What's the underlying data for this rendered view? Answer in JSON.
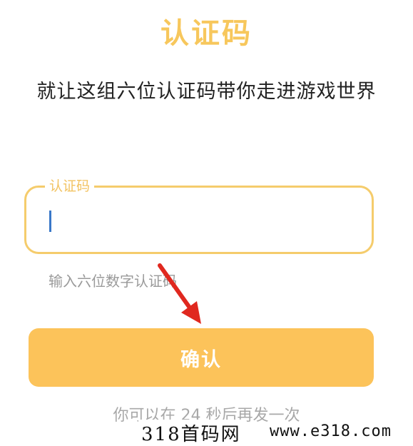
{
  "header": {
    "title": "认证码",
    "subtitle": "就让这组六位认证码带你走进游戏世界"
  },
  "form": {
    "field_label": "认证码",
    "input_value": "",
    "helper_text": "输入六位数字认证码",
    "confirm_label": "确认"
  },
  "footer": {
    "resend_text": "你可以在 24 秒后再发一次"
  },
  "watermark": {
    "left": "318首码网",
    "right": "www.e318.com"
  },
  "colors": {
    "accent": "#f7c75c",
    "button": "#fcc35a",
    "annotation_arrow": "#e0281f",
    "caret": "#3a78c8"
  },
  "icons": {
    "annotation": "red-arrow-icon"
  }
}
